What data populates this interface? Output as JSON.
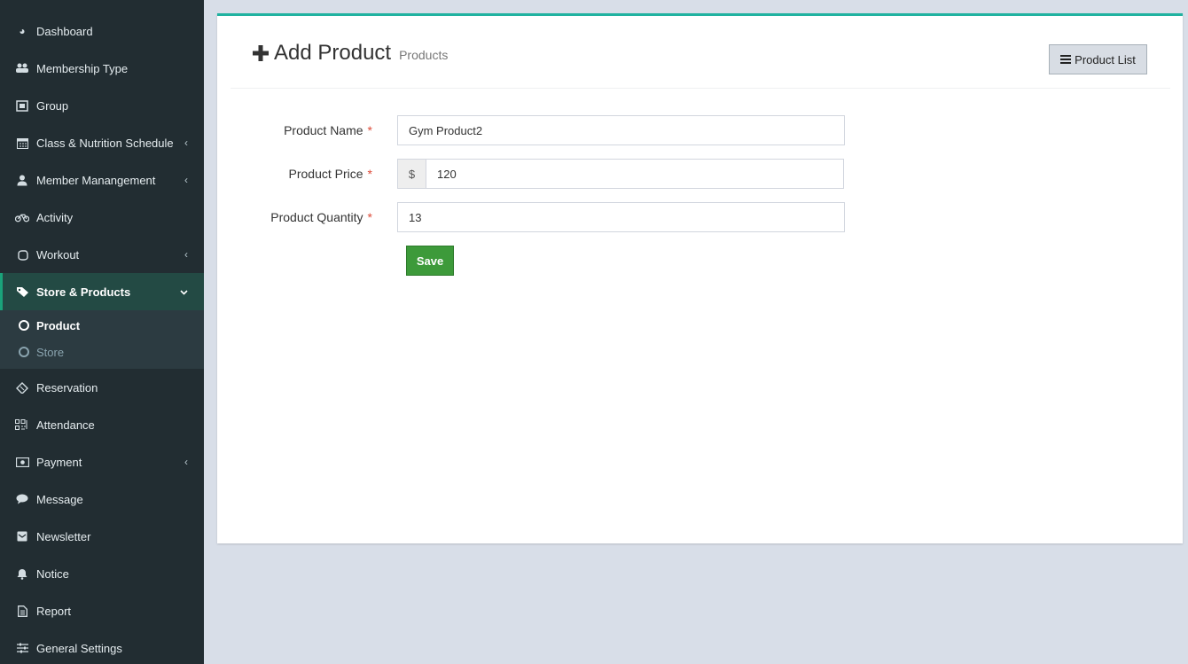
{
  "sidebar": {
    "items": [
      {
        "label": "Dashboard",
        "icon": "dashboard-icon",
        "glyph": "◕",
        "chevron": false
      },
      {
        "label": "Membership Type",
        "icon": "users-icon",
        "glyph": "👥",
        "chevron": false
      },
      {
        "label": "Group",
        "icon": "group-icon",
        "glyph": "▣",
        "chevron": false
      },
      {
        "label": "Class & Nutrition Schedule",
        "icon": "calendar-icon",
        "glyph": "▦",
        "chevron": true
      },
      {
        "label": "Member Manangement",
        "icon": "user-icon",
        "glyph": "●",
        "chevron": true
      },
      {
        "label": "Activity",
        "icon": "bicycle-icon",
        "glyph": "⚭",
        "chevron": false
      },
      {
        "label": "Workout",
        "icon": "hand-icon",
        "glyph": "✋",
        "chevron": true
      },
      {
        "label": "Store & Products",
        "icon": "tags-icon",
        "glyph": "◆",
        "chevron": true,
        "active": true
      }
    ],
    "submenu": [
      {
        "label": "Product",
        "active": true
      },
      {
        "label": "Store",
        "active": false
      }
    ],
    "items_after": [
      {
        "label": "Reservation",
        "icon": "ticket-icon",
        "glyph": "◈",
        "chevron": false
      },
      {
        "label": "Attendance",
        "icon": "qrcode-icon",
        "glyph": "▩",
        "chevron": false
      },
      {
        "label": "Payment",
        "icon": "money-icon",
        "glyph": "▭",
        "chevron": true
      },
      {
        "label": "Message",
        "icon": "comment-icon",
        "glyph": "●",
        "chevron": false
      },
      {
        "label": "Newsletter",
        "icon": "envelope-icon",
        "glyph": "✉",
        "chevron": false
      },
      {
        "label": "Notice",
        "icon": "bell-icon",
        "glyph": "🔔",
        "chevron": false
      },
      {
        "label": "Report",
        "icon": "file-icon",
        "glyph": "▤",
        "chevron": false
      },
      {
        "label": "General Settings",
        "icon": "sliders-icon",
        "glyph": "☰",
        "chevron": false
      }
    ]
  },
  "header": {
    "title": "Add Product",
    "subtitle": "Products",
    "list_button": "Product List"
  },
  "form": {
    "name_label": "Product Name",
    "name_value": "Gym Product2",
    "price_label": "Product Price",
    "price_addon": "$",
    "price_value": "120",
    "qty_label": "Product Quantity",
    "qty_value": "13",
    "required_mark": "*",
    "save_label": "Save"
  },
  "colors": {
    "sidebar_bg": "#222d32",
    "accent_top": "#20b2a0",
    "save_button": "#3d9a3a"
  }
}
